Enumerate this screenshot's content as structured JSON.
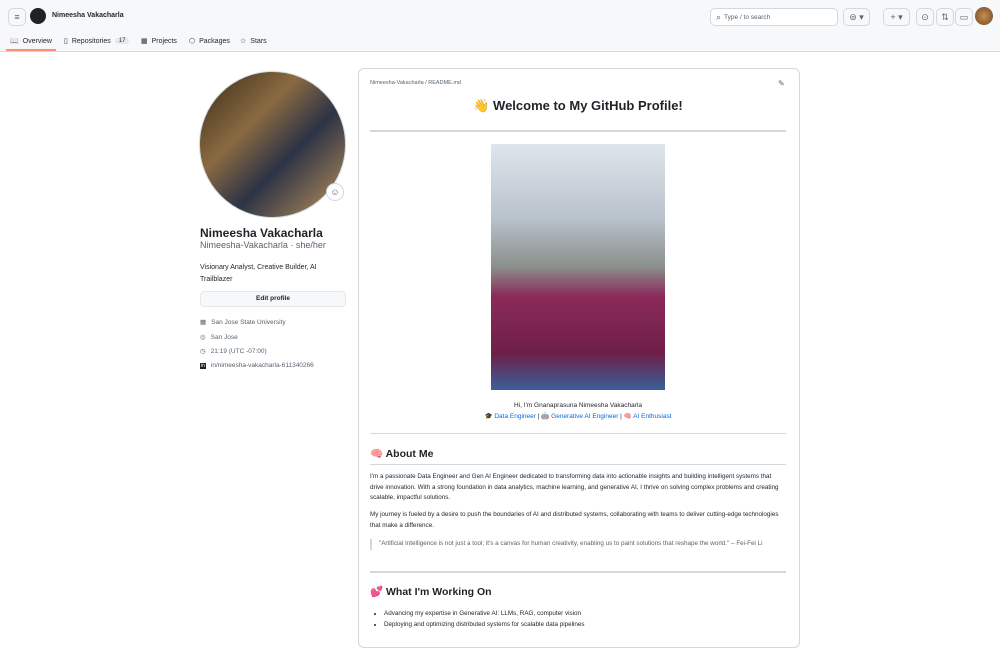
{
  "header": {
    "username": "Nimeesha Vakacharla",
    "search_placeholder": "Type / to search"
  },
  "tabs": [
    {
      "label": "Overview",
      "icon": "book-icon"
    },
    {
      "label": "Repositories",
      "count": "17",
      "icon": "repo-icon"
    },
    {
      "label": "Projects",
      "icon": "table-icon"
    },
    {
      "label": "Packages",
      "icon": "package-icon"
    },
    {
      "label": "Stars",
      "icon": "star-icon"
    }
  ],
  "profile": {
    "name": "Nimeesha Vakacharla",
    "login": "Nimeesha-Vakacharla · she/her",
    "bio": "Visionary Analyst, Creative Builder, AI Trailblazer",
    "edit_label": "Edit profile",
    "org": "San Jose State University",
    "location": "San Jose",
    "time": "21:19 (UTC -07:00)",
    "linkedin": "in/nimeesha-vakacharla-611340266"
  },
  "readme": {
    "path": "Nimeesha-Vakacharla / README.md",
    "title": "👋 Welcome to My GitHub Profile!",
    "intro": "Hi, I'm Gnanaprasuna Nimeesha Vakacharla",
    "roles": [
      "🎓 Data Engineer",
      "🤖 Generative AI Engineer",
      "🧠 AI Enthusiast"
    ],
    "about_title": "🧠 About Me",
    "about_p1": "I'm a passionate Data Engineer and Gen AI Engineer dedicated to transforming data into actionable insights and building intelligent systems that drive innovation. With a strong foundation in data analytics, machine learning, and generative AI, I thrive on solving complex problems and creating scalable, impactful solutions.",
    "about_p2": "My journey is fueled by a desire to push the boundaries of AI and distributed systems, collaborating with teams to deliver cutting-edge technologies that make a difference.",
    "quote": "\"Artificial Intelligence is not just a tool; it's a canvas for human creativity, enabling us to paint solutions that reshape the world.\" – Fei-Fei Li",
    "working_title": "💕 What I'm Working On",
    "working": [
      "Advancing my expertise in Generative AI: LLMs, RAG, computer vision",
      "Deploying and optimizing distributed systems for scalable data pipelines"
    ]
  },
  "colors": {
    "accent": "#fd8c73",
    "link": "#0969da"
  }
}
